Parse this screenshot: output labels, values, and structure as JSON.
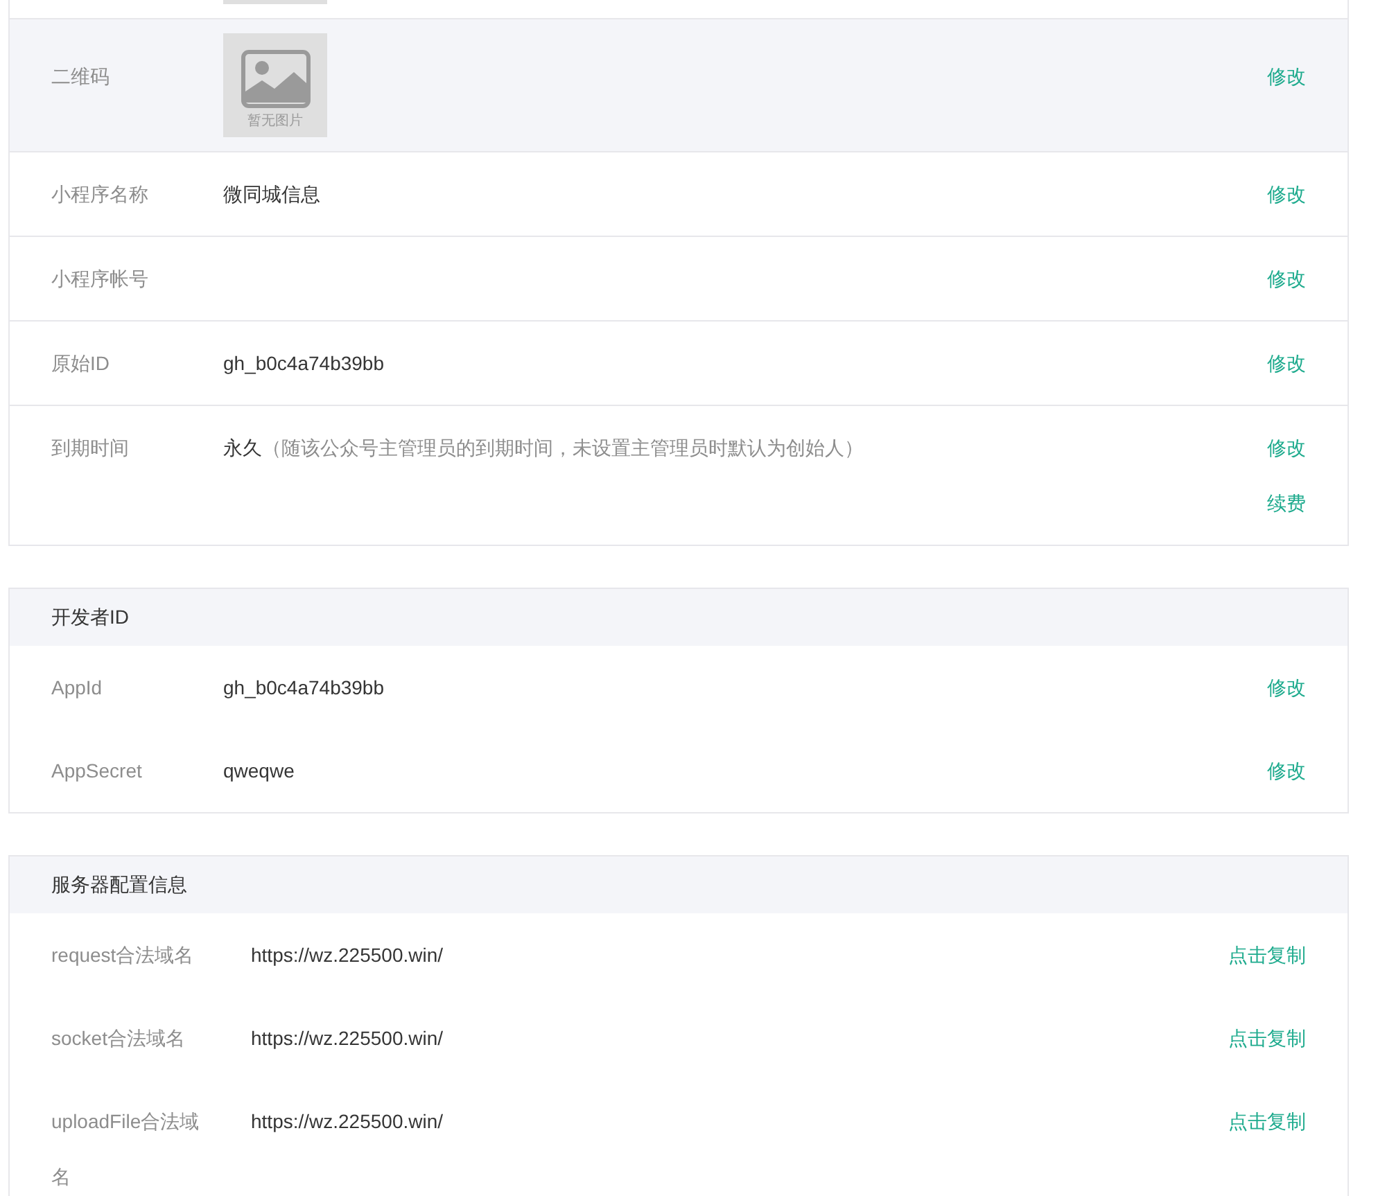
{
  "basic_info": {
    "rows": [
      {
        "kind": "image",
        "label": "二维码",
        "placeholder_text": "暂无图片",
        "actions": [
          "修改"
        ]
      },
      {
        "kind": "text",
        "label": "小程序名称",
        "value": "微同城信息",
        "actions": [
          "修改"
        ]
      },
      {
        "kind": "text",
        "label": "小程序帐号",
        "actions": [
          "修改"
        ]
      },
      {
        "kind": "text",
        "label": "原始ID",
        "value": "gh_b0c4a74b39bb",
        "actions": [
          "修改"
        ]
      },
      {
        "kind": "text",
        "label": "到期时间",
        "value": "永久",
        "note": "（随该公众号主管理员的到期时间，未设置主管理员时默认为创始人）",
        "actions": [
          "修改",
          "续费"
        ]
      }
    ]
  },
  "developer_id": {
    "title": "开发者ID",
    "rows": [
      {
        "label": "AppId",
        "value": "gh_b0c4a74b39bb",
        "action": "修改"
      },
      {
        "label": "AppSecret",
        "value": "qweqwe",
        "action": "修改"
      }
    ]
  },
  "server_config": {
    "title": "服务器配置信息",
    "rows": [
      {
        "label": "request合法域名",
        "value": "https://wz.225500.win/",
        "action": "点击复制"
      },
      {
        "label": "socket合法域名",
        "value": "https://wz.225500.win/",
        "action": "点击复制"
      },
      {
        "label": "uploadFile合法域名",
        "value": "https://wz.225500.win/",
        "action": "点击复制"
      }
    ]
  }
}
